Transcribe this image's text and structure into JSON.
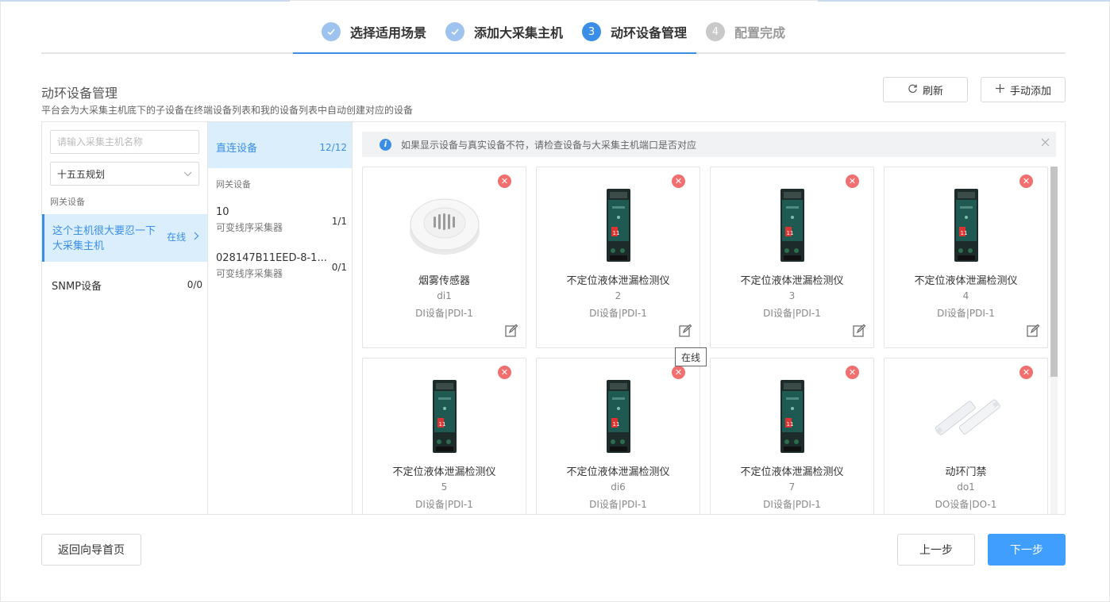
{
  "steps": [
    {
      "number": "",
      "label": "选择适用场景",
      "state": "done"
    },
    {
      "number": "",
      "label": "添加大采集主机",
      "state": "done"
    },
    {
      "number": "3",
      "label": "动环设备管理",
      "state": "current"
    },
    {
      "number": "4",
      "label": "配置完成",
      "state": "todo"
    }
  ],
  "header": {
    "title": "动环设备管理",
    "subtitle": "平台会为大采集主机底下的子设备在终端设备列表和我的设备列表中自动创建对应的设备",
    "refresh_label": "刷新",
    "add_label": "手动添加"
  },
  "hosts": {
    "search_placeholder": "请输入采集主机名称",
    "plan_selected": "十五五规划",
    "group_label": "网关设备",
    "active_host_name": "这个主机很大要忍一下大采集主机",
    "active_host_status": "在线",
    "snmp_label": "SNMP设备",
    "snmp_count": "0/0"
  },
  "subdevices": {
    "direct_label": "直连设备",
    "direct_count": "12/12",
    "gateway_label": "网关设备",
    "items": [
      {
        "title": "10",
        "sub": "可变线序采集器",
        "count": "1/1"
      },
      {
        "title": "028147B11EED-8-1...",
        "sub": "可变线序采集器",
        "count": "0/1"
      }
    ]
  },
  "notice": {
    "text": "如果显示设备与真实设备不符，请检查设备与大采集主机端口是否对应"
  },
  "devices": [
    {
      "name": "烟雾传感器",
      "code": "di1",
      "type": "DI设备|PDI-1",
      "image": "smoke-detector"
    },
    {
      "name": "不定位液体泄漏检测仪",
      "code": "2",
      "type": "DI设备|PDI-1",
      "image": "leak-detector"
    },
    {
      "name": "不定位液体泄漏检测仪",
      "code": "3",
      "type": "DI设备|PDI-1",
      "image": "leak-detector"
    },
    {
      "name": "不定位液体泄漏检测仪",
      "code": "4",
      "type": "DI设备|PDI-1",
      "image": "leak-detector"
    },
    {
      "name": "不定位液体泄漏检测仪",
      "code": "5",
      "type": "DI设备|PDI-1",
      "image": "leak-detector"
    },
    {
      "name": "不定位液体泄漏检测仪",
      "code": "di6",
      "type": "DI设备|PDI-1",
      "image": "leak-detector"
    },
    {
      "name": "不定位液体泄漏检测仪",
      "code": "7",
      "type": "DI设备|PDI-1",
      "image": "leak-detector"
    },
    {
      "name": "动环门禁",
      "code": "do1",
      "type": "DO设备|DO-1",
      "image": "door-sensor"
    }
  ],
  "tooltip": "在线",
  "footer": {
    "home_label": "返回向导首页",
    "prev_label": "上一步",
    "next_label": "下一步"
  },
  "colors": {
    "primary": "#409eff",
    "active_bg": "#dbeefc",
    "delete": "#f26f6f"
  }
}
